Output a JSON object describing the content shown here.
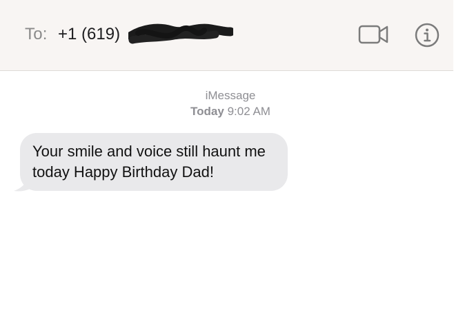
{
  "header": {
    "to_label": "To:",
    "recipient_prefix": "+1 (619)",
    "actions": {
      "video_icon": "video-camera-icon",
      "info_icon": "info-circle-icon"
    }
  },
  "conversation": {
    "service": "iMessage",
    "timestamp_day": "Today",
    "timestamp_time": "9:02 AM",
    "messages": [
      {
        "direction": "incoming",
        "text": "Your smile and voice still haunt me today Happy Birthday Dad!"
      }
    ]
  },
  "colors": {
    "header_bg": "#f8f5f3",
    "incoming_bubble": "#e9e9eb",
    "secondary_text": "#8e8e93",
    "icon_gray": "#7b7b7b"
  }
}
